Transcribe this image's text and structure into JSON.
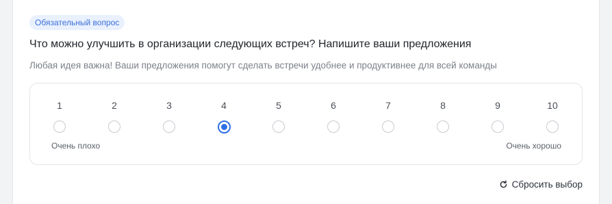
{
  "question": {
    "badge": "Обязательный вопрос",
    "title": "Что можно улучшить в организации следующих встреч? Напишите ваши предложения",
    "subtitle": "Любая идея важна! Ваши предложения помогут сделать встречи удобнее и продуктивнее для всей команды"
  },
  "scale": {
    "options": [
      "1",
      "2",
      "3",
      "4",
      "5",
      "6",
      "7",
      "8",
      "9",
      "10"
    ],
    "selected": "4",
    "min_label": "Очень плохо",
    "max_label": "Очень хорошо"
  },
  "reset": {
    "label": "Сбросить выбор",
    "icon": "refresh-icon"
  },
  "colors": {
    "accent": "#2f6fe4",
    "badge_bg": "#eaf1fe",
    "badge_text": "#3a6fd8"
  }
}
